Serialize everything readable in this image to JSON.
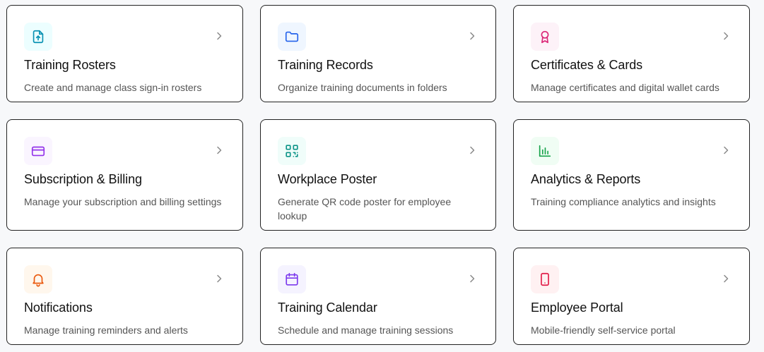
{
  "cards": [
    {
      "title": "Training Rosters",
      "description": "Create and manage class sign-in rosters",
      "icon": "file-upload-icon",
      "accent": "#0891b2",
      "icon_bg": "#ecfeff"
    },
    {
      "title": "Training Records",
      "description": "Organize training documents in folders",
      "icon": "folder-icon",
      "accent": "#2563eb",
      "icon_bg": "#eff6ff"
    },
    {
      "title": "Certificates & Cards",
      "description": "Manage certificates and digital wallet cards",
      "icon": "award-icon",
      "accent": "#db2777",
      "icon_bg": "#fdf2f8"
    },
    {
      "title": "Subscription & Billing",
      "description": "Manage your subscription and billing settings",
      "icon": "credit-card-icon",
      "accent": "#9333ea",
      "icon_bg": "#faf5ff"
    },
    {
      "title": "Workplace Poster",
      "description": "Generate QR code poster for employee lookup",
      "icon": "qr-code-icon",
      "accent": "#0d9488",
      "icon_bg": "#f0fdfa"
    },
    {
      "title": "Analytics & Reports",
      "description": "Training compliance analytics and insights",
      "icon": "bar-chart-icon",
      "accent": "#16a34a",
      "icon_bg": "#f0fdf4"
    },
    {
      "title": "Notifications",
      "description": "Manage training reminders and alerts",
      "icon": "bell-icon",
      "accent": "#ea580c",
      "icon_bg": "#fff7ed"
    },
    {
      "title": "Training Calendar",
      "description": "Schedule and manage training sessions",
      "icon": "calendar-icon",
      "accent": "#7c3aed",
      "icon_bg": "#f5f3ff"
    },
    {
      "title": "Employee Portal",
      "description": "Mobile-friendly self-service portal",
      "icon": "smartphone-icon",
      "accent": "#e11d48",
      "icon_bg": "#fff1f2"
    }
  ],
  "chevron_icon": "chevron-right-icon"
}
